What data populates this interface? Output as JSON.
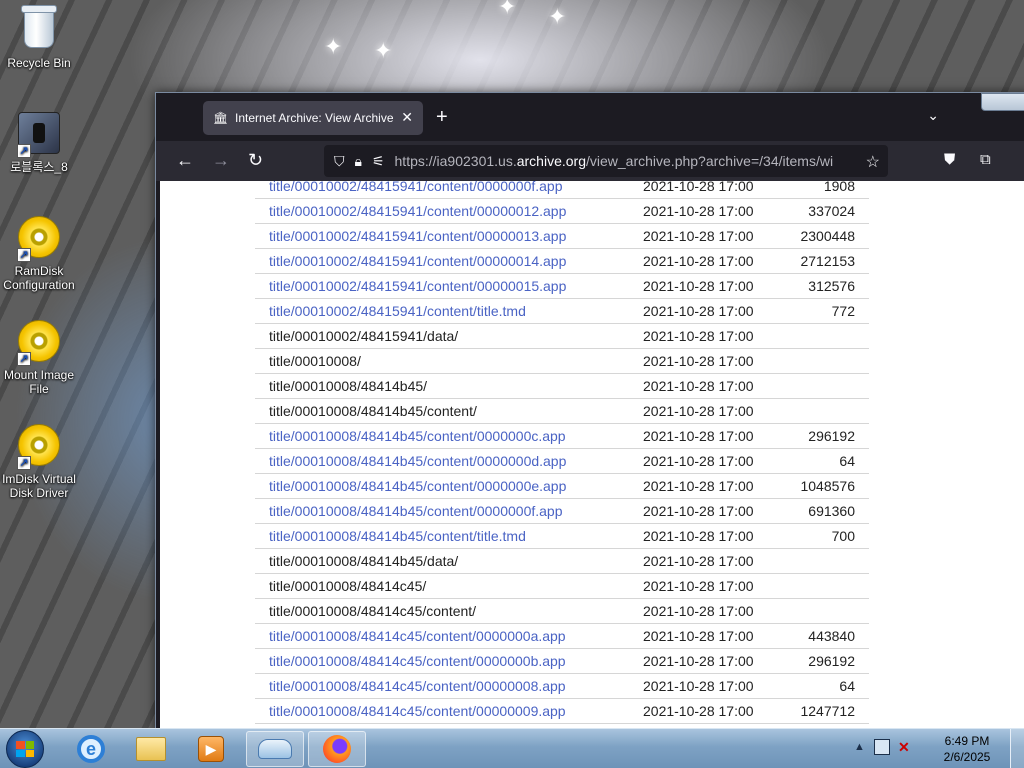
{
  "desktop": {
    "icons": [
      {
        "label": "Recycle Bin",
        "icon": "recycle-bin-icon"
      },
      {
        "label": "로블록스_8",
        "icon": "roblox-shortcut-icon"
      },
      {
        "label": "RamDisk Configuration",
        "icon": "disc-icon"
      },
      {
        "label": "Mount Image File",
        "icon": "disc-icon"
      },
      {
        "label": "ImDisk Virtual Disk Driver",
        "icon": "disc-icon"
      }
    ]
  },
  "browser": {
    "tab_title": "Internet Archive: View Archive",
    "tab_close": "✕",
    "new_tab": "+",
    "tab_list": "⌄",
    "url_prefix": "https://ia902301.us.",
    "url_host": "archive.org",
    "url_suffix": "/view_archive.php?archive=/34/items/wi",
    "back": "←",
    "forward": "→",
    "reload": "↻",
    "bookmark_star": "☆"
  },
  "archive_rows": [
    {
      "name": "title/00010002/48415941/content/0000000f.app",
      "date": "2021-10-28 17:00",
      "size": "1908",
      "link": true
    },
    {
      "name": "title/00010002/48415941/content/00000012.app",
      "date": "2021-10-28 17:00",
      "size": "337024",
      "link": true
    },
    {
      "name": "title/00010002/48415941/content/00000013.app",
      "date": "2021-10-28 17:00",
      "size": "2300448",
      "link": true
    },
    {
      "name": "title/00010002/48415941/content/00000014.app",
      "date": "2021-10-28 17:00",
      "size": "2712153",
      "link": true
    },
    {
      "name": "title/00010002/48415941/content/00000015.app",
      "date": "2021-10-28 17:00",
      "size": "312576",
      "link": true
    },
    {
      "name": "title/00010002/48415941/content/title.tmd",
      "date": "2021-10-28 17:00",
      "size": "772",
      "link": true
    },
    {
      "name": "title/00010002/48415941/data/",
      "date": "2021-10-28 17:00",
      "size": "",
      "link": false
    },
    {
      "name": "title/00010008/",
      "date": "2021-10-28 17:00",
      "size": "",
      "link": false
    },
    {
      "name": "title/00010008/48414b45/",
      "date": "2021-10-28 17:00",
      "size": "",
      "link": false
    },
    {
      "name": "title/00010008/48414b45/content/",
      "date": "2021-10-28 17:00",
      "size": "",
      "link": false
    },
    {
      "name": "title/00010008/48414b45/content/0000000c.app",
      "date": "2021-10-28 17:00",
      "size": "296192",
      "link": true
    },
    {
      "name": "title/00010008/48414b45/content/0000000d.app",
      "date": "2021-10-28 17:00",
      "size": "64",
      "link": true
    },
    {
      "name": "title/00010008/48414b45/content/0000000e.app",
      "date": "2021-10-28 17:00",
      "size": "1048576",
      "link": true
    },
    {
      "name": "title/00010008/48414b45/content/0000000f.app",
      "date": "2021-10-28 17:00",
      "size": "691360",
      "link": true
    },
    {
      "name": "title/00010008/48414b45/content/title.tmd",
      "date": "2021-10-28 17:00",
      "size": "700",
      "link": true
    },
    {
      "name": "title/00010008/48414b45/data/",
      "date": "2021-10-28 17:00",
      "size": "",
      "link": false
    },
    {
      "name": "title/00010008/48414c45/",
      "date": "2021-10-28 17:00",
      "size": "",
      "link": false
    },
    {
      "name": "title/00010008/48414c45/content/",
      "date": "2021-10-28 17:00",
      "size": "",
      "link": false
    },
    {
      "name": "title/00010008/48414c45/content/0000000a.app",
      "date": "2021-10-28 17:00",
      "size": "443840",
      "link": true
    },
    {
      "name": "title/00010008/48414c45/content/0000000b.app",
      "date": "2021-10-28 17:00",
      "size": "296192",
      "link": true
    },
    {
      "name": "title/00010008/48414c45/content/00000008.app",
      "date": "2021-10-28 17:00",
      "size": "64",
      "link": true
    },
    {
      "name": "title/00010008/48414c45/content/00000009.app",
      "date": "2021-10-28 17:00",
      "size": "1247712",
      "link": true
    }
  ],
  "taskbar": {
    "time": "6:49 PM",
    "date": "2/6/2025",
    "tray_arrow": "▲",
    "volume_muted": "✕",
    "media_glyph": "▶",
    "ie_glyph": "e"
  },
  "colors": {
    "link": "#4a63c4",
    "firefox_chrome": "#2b2a33",
    "tab_active": "#42414d"
  }
}
